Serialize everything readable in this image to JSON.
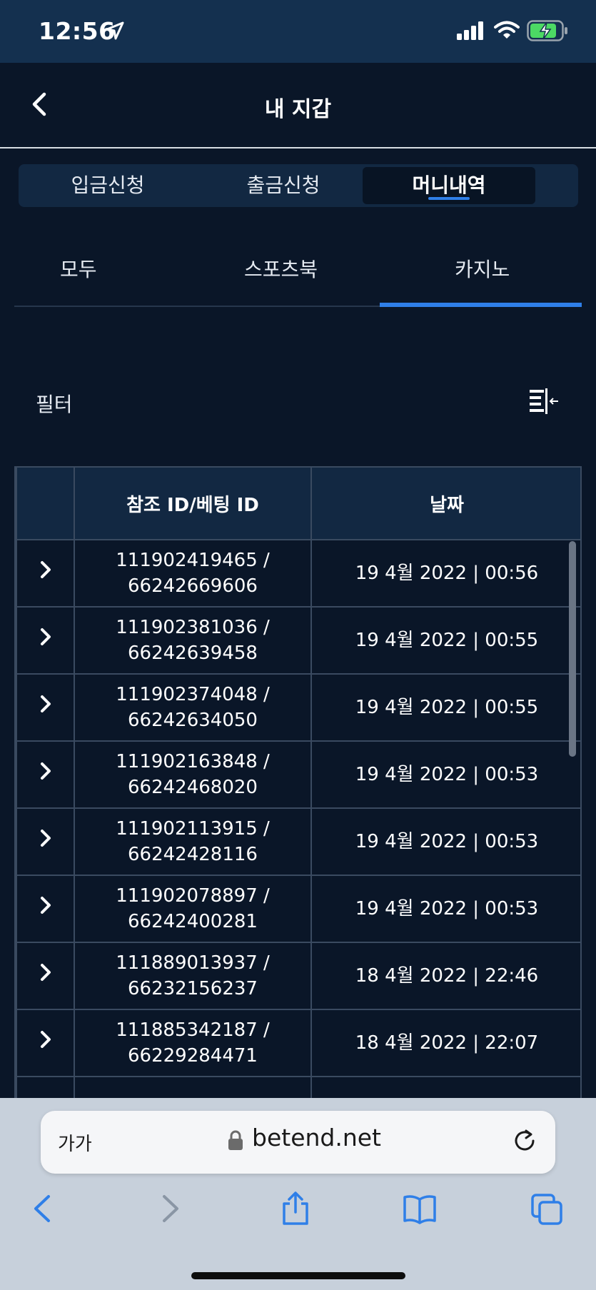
{
  "status_bar": {
    "time": "12:56"
  },
  "header": {
    "title": "내 지갑"
  },
  "main_tabs": [
    {
      "label": "입금신청"
    },
    {
      "label": "출금신청"
    },
    {
      "label": "머니내역"
    }
  ],
  "sub_tabs": [
    {
      "label": "모두"
    },
    {
      "label": "스포츠북"
    },
    {
      "label": "카지노"
    }
  ],
  "filter": {
    "label": "필터"
  },
  "table": {
    "headers": [
      "",
      "참조 ID/베팅 ID",
      "날짜"
    ],
    "rows": [
      {
        "ref_id": "111902419465 /",
        "bet_id": "66242669606",
        "date": "19 4월 2022 | 00:56"
      },
      {
        "ref_id": "111902381036 /",
        "bet_id": "66242639458",
        "date": "19 4월 2022 | 00:55"
      },
      {
        "ref_id": "111902374048 /",
        "bet_id": "66242634050",
        "date": "19 4월 2022 | 00:55"
      },
      {
        "ref_id": "111902163848 /",
        "bet_id": "66242468020",
        "date": "19 4월 2022 | 00:53"
      },
      {
        "ref_id": "111902113915 /",
        "bet_id": "66242428116",
        "date": "19 4월 2022 | 00:53"
      },
      {
        "ref_id": "111902078897 /",
        "bet_id": "66242400281",
        "date": "19 4월 2022 | 00:53"
      },
      {
        "ref_id": "111889013937 /",
        "bet_id": "66232156237",
        "date": "18 4월 2022 | 22:46"
      },
      {
        "ref_id": "111885342187 /",
        "bet_id": "66229284471",
        "date": "18 4월 2022 | 22:07"
      }
    ]
  },
  "browser": {
    "text_size_label": "가가",
    "url": "betend.net"
  },
  "colors": {
    "background": "#0a1628",
    "accent": "#2f7fe8",
    "header_cell": "#122842",
    "status_bar": "#14304f",
    "battery": "#4cd964"
  }
}
